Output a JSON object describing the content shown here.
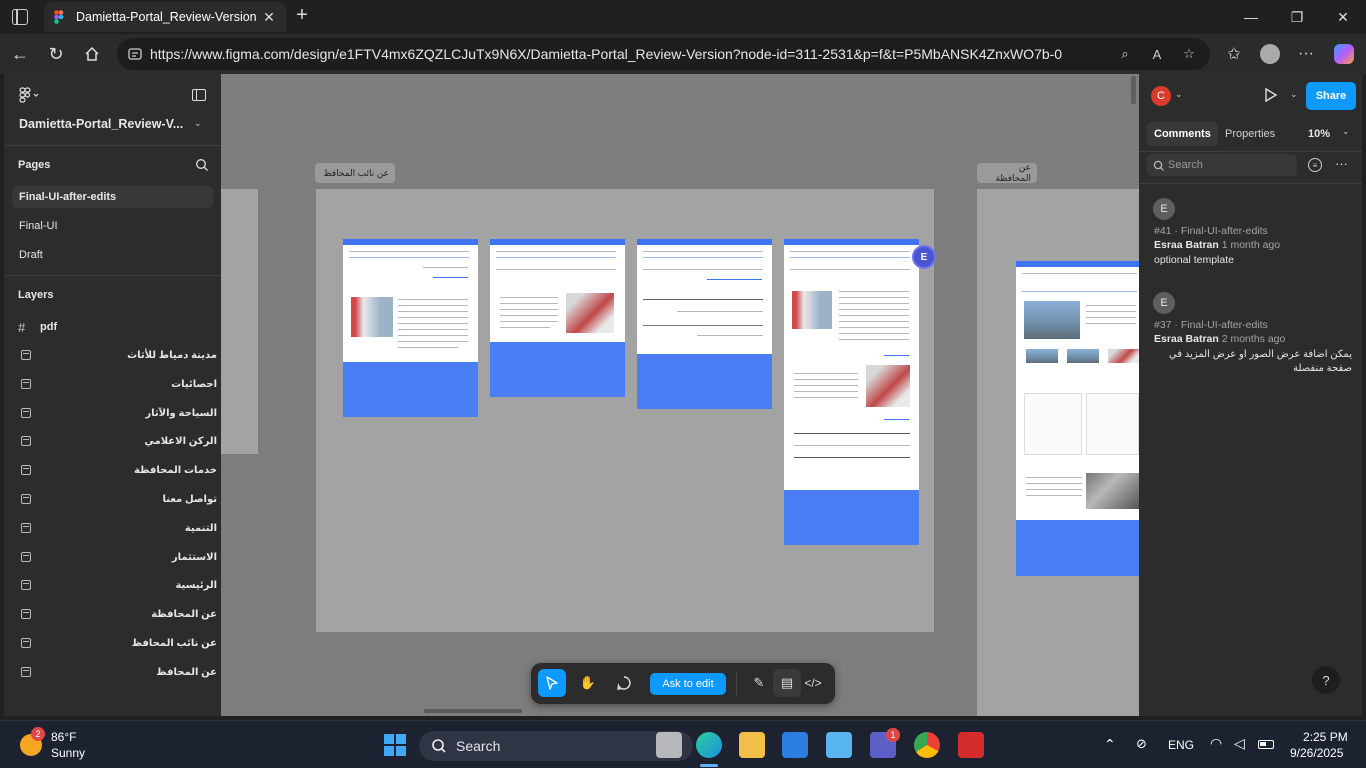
{
  "browser": {
    "tab_title": "Damietta-Portal_Review-Version –",
    "url": "https://www.figma.com/design/e1FTV4mx6ZQZLCJuTx9N6X/Damietta-Portal_Review-Version?node-id=311-2531&p=f&t=P5MbANSK4ZnxWO7b-0"
  },
  "figma": {
    "file_name": "Damietta-Portal_Review-V...",
    "pages_label": "Pages",
    "pages": [
      {
        "label": "Final-UI-after-edits",
        "selected": true
      },
      {
        "label": "Final-UI",
        "selected": false
      },
      {
        "label": "Draft",
        "selected": false
      }
    ],
    "layers_label": "Layers",
    "root_layer": "pdf",
    "layers": [
      "مدينة دمياط للأثاث",
      "احصائيات",
      "السياحة والآثار",
      "الركن الاعلامي",
      "خدمات المحافظة",
      "تواصل معنا",
      "التنمية",
      "الاستثمار",
      "الرئيسية",
      "عن المحافظة",
      "عن نائب المحافظ",
      "عن المحافظ"
    ],
    "canvas": {
      "frame_label_1": "عن نائب المحافظ",
      "frame_label_2": "عن المحافظة",
      "collaborator_initial": "E"
    },
    "toolbar": {
      "ask_to_edit": "Ask to edit"
    },
    "right_panel": {
      "user_initial": "C",
      "share_label": "Share",
      "tabs": [
        "Comments",
        "Properties"
      ],
      "zoom": "10%",
      "search_placeholder": "Search",
      "comments": [
        {
          "initial": "E",
          "ref": "#41 · Final-UI-after-edits",
          "author": "Esraa Batran",
          "time": "1 month ago",
          "body": "optional template"
        },
        {
          "initial": "E",
          "ref": "#37 · Final-UI-after-edits",
          "author": "Esraa Batran",
          "time": "2 months ago",
          "body": "يمكن اضافة عرض الصور او عرض المزيد في صفحة منفصلة"
        }
      ],
      "help_label": "?"
    }
  },
  "taskbar": {
    "weather_temp": "86°F",
    "weather_desc": "Sunny",
    "weather_badge": "2",
    "search_label": "Search",
    "teams_badge": "1",
    "lang": "ENG",
    "time": "2:25 PM",
    "date": "9/26/2025"
  },
  "colors": {
    "figma_blue": "#0d99ff",
    "mock_header_blue": "#3e74f2",
    "avatar_red": "#d93c2c",
    "collab_purple": "#4a55d6"
  }
}
